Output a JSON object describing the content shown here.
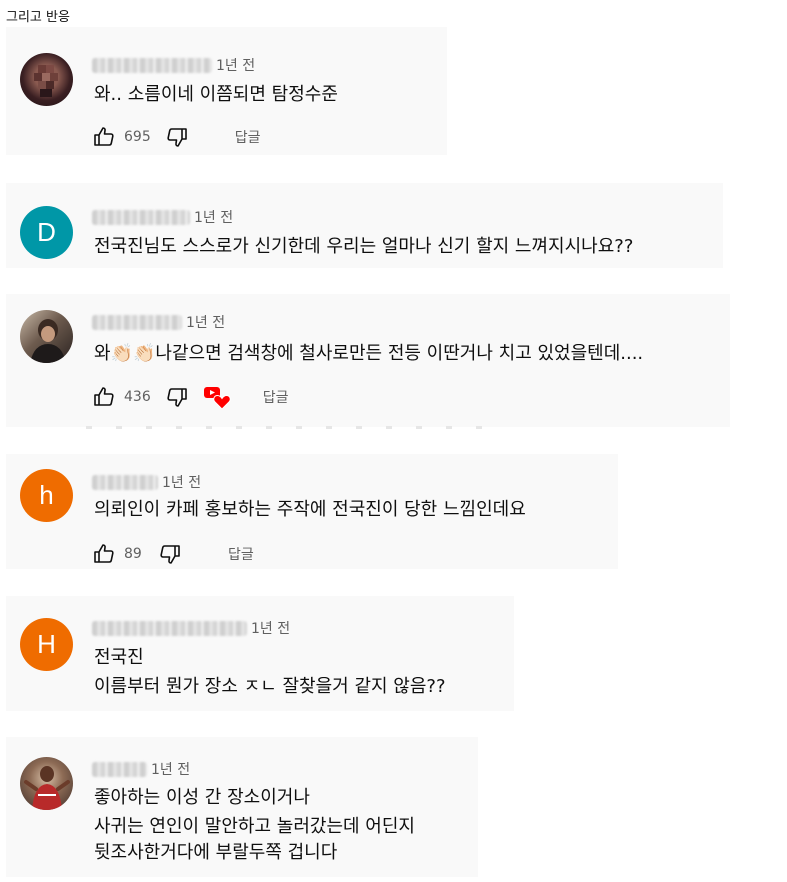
{
  "page_title": "그리고 반응",
  "comments": [
    {
      "time": "1년 전",
      "lines": [
        "와.. 소름이네 이쯤되면 탐정수준"
      ],
      "likes": "695",
      "reply_label": "답글"
    },
    {
      "avatar_letter": "D",
      "avatar_color": "#0097a7",
      "time": "1년 전",
      "lines": [
        "전국진님도 스스로가 신기한데 우리는 얼마나 신기 할지 느껴지시나요??"
      ]
    },
    {
      "time": "1년 전",
      "lines": [
        "와👏🏻👏🏻나같으면 검색창에 철사로만든 전등 이딴거나 치고 있었을텐데...."
      ],
      "likes": "436",
      "reply_label": "답글"
    },
    {
      "avatar_letter": "h",
      "avatar_color": "#ef6c00",
      "time": "1년 전",
      "lines": [
        "의뢰인이 카페 홍보하는 주작에 전국진이 당한 느낌인데요"
      ],
      "likes": "89",
      "reply_label": "답글"
    },
    {
      "avatar_letter": "H",
      "avatar_color": "#ef6c00",
      "time": "1년 전",
      "lines": [
        "전국진",
        "이름부터 뭔가 장소 ㅈㄴ 잘찾을거 같지 않음??"
      ]
    },
    {
      "time": "1년 전",
      "lines": [
        "좋아하는 이성 간 장소이거나",
        "사귀는 연인이 말안하고 놀러갔는데 어딘지",
        "뒷조사한거다에 부랄두쪽 겁니다"
      ]
    }
  ],
  "colors": {
    "card_bg": "#f9f9f9",
    "meta_gray": "#606060",
    "heart_red": "#ff0000"
  }
}
